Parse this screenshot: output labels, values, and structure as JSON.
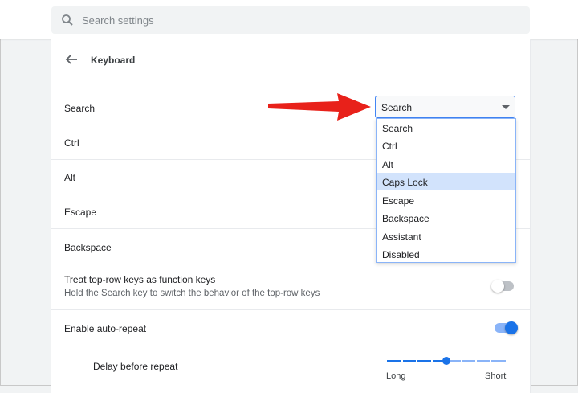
{
  "search": {
    "placeholder": "Search settings"
  },
  "page": {
    "title": "Keyboard"
  },
  "rows": [
    {
      "label": "Search"
    },
    {
      "label": "Ctrl"
    },
    {
      "label": "Alt"
    },
    {
      "label": "Escape"
    },
    {
      "label": "Backspace"
    }
  ],
  "search_key_select": {
    "value": "Search",
    "options": [
      "Search",
      "Ctrl",
      "Alt",
      "Caps Lock",
      "Escape",
      "Backspace",
      "Assistant",
      "Disabled"
    ],
    "highlighted": "Caps Lock"
  },
  "function_keys": {
    "label": "Treat top-row keys as function keys",
    "sub": "Hold the Search key to switch the behavior of the top-row keys",
    "enabled": false
  },
  "auto_repeat": {
    "label": "Enable auto-repeat",
    "enabled": true
  },
  "delay": {
    "label": "Delay before repeat",
    "min_label": "Long",
    "max_label": "Short",
    "value_fraction": 0.5
  },
  "colors": {
    "accent": "#1a73e8",
    "annotation_arrow": "#e8211a"
  },
  "icons": {
    "search": "search-icon",
    "back": "back-arrow-icon",
    "annotation": "red-arrow-annotation"
  }
}
